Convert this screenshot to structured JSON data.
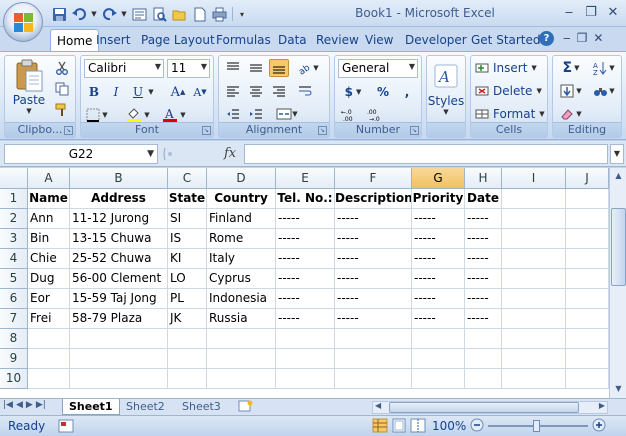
{
  "window": {
    "title": "Book1 - Microsoft Excel"
  },
  "tabs": [
    "Home",
    "Insert",
    "Page Layout",
    "Formulas",
    "Data",
    "Review",
    "View",
    "Developer",
    "Get Started"
  ],
  "ribbon": {
    "clipboard": {
      "label": "Clipbo...",
      "paste_label": "Paste"
    },
    "font": {
      "label": "Font",
      "font_name": "Calibri",
      "font_size": "11"
    },
    "alignment": {
      "label": "Alignment"
    },
    "number": {
      "label": "Number",
      "format": "General",
      "currency": "$",
      "percent": "%",
      "comma": ","
    },
    "styles": {
      "label": "Styles"
    },
    "cells": {
      "label": "Cells",
      "insert": "Insert",
      "delete": "Delete",
      "format": "Format"
    },
    "editing": {
      "label": "Editing"
    }
  },
  "formula_bar": {
    "name_box": "G22",
    "fx": "fx",
    "formula": ""
  },
  "grid": {
    "columns": [
      "A",
      "B",
      "C",
      "D",
      "E",
      "F",
      "G",
      "H",
      "I",
      "J"
    ],
    "selected_column": "G",
    "rows": [
      "1",
      "2",
      "3",
      "4",
      "5",
      "6",
      "7",
      "8",
      "9",
      "10"
    ],
    "cells": [
      [
        "Name",
        "Address",
        "State",
        "Country",
        "Tel. No.:",
        "Description",
        "Priority",
        "Date"
      ],
      [
        "Ann",
        "11-12 Jurong",
        "SI",
        "Finland",
        "-----",
        "-----",
        "-----",
        "-----"
      ],
      [
        "Bin",
        "13-15 Chuwa",
        "IS",
        "Rome",
        "-----",
        "-----",
        "-----",
        "-----"
      ],
      [
        "Chie",
        "25-52 Chuwa",
        "KI",
        "Italy",
        "-----",
        "-----",
        "-----",
        "-----"
      ],
      [
        "Dug",
        "56-00 Clement",
        "LO",
        "Cyprus",
        "-----",
        "-----",
        "-----",
        "-----"
      ],
      [
        "Eor",
        "15-59 Taj Jong",
        "PL",
        "Indonesia",
        "-----",
        "-----",
        "-----",
        "-----"
      ],
      [
        "Frei",
        "58-79 Plaza",
        "JK",
        "Russia",
        "-----",
        "-----",
        "-----",
        "-----"
      ]
    ]
  },
  "sheets": [
    "Sheet1",
    "Sheet2",
    "Sheet3"
  ],
  "active_sheet": "Sheet1",
  "status": {
    "text": "Ready",
    "zoom": "100%"
  },
  "colors": {
    "selected_header": "#f1c15f",
    "accent": "#15428b"
  }
}
